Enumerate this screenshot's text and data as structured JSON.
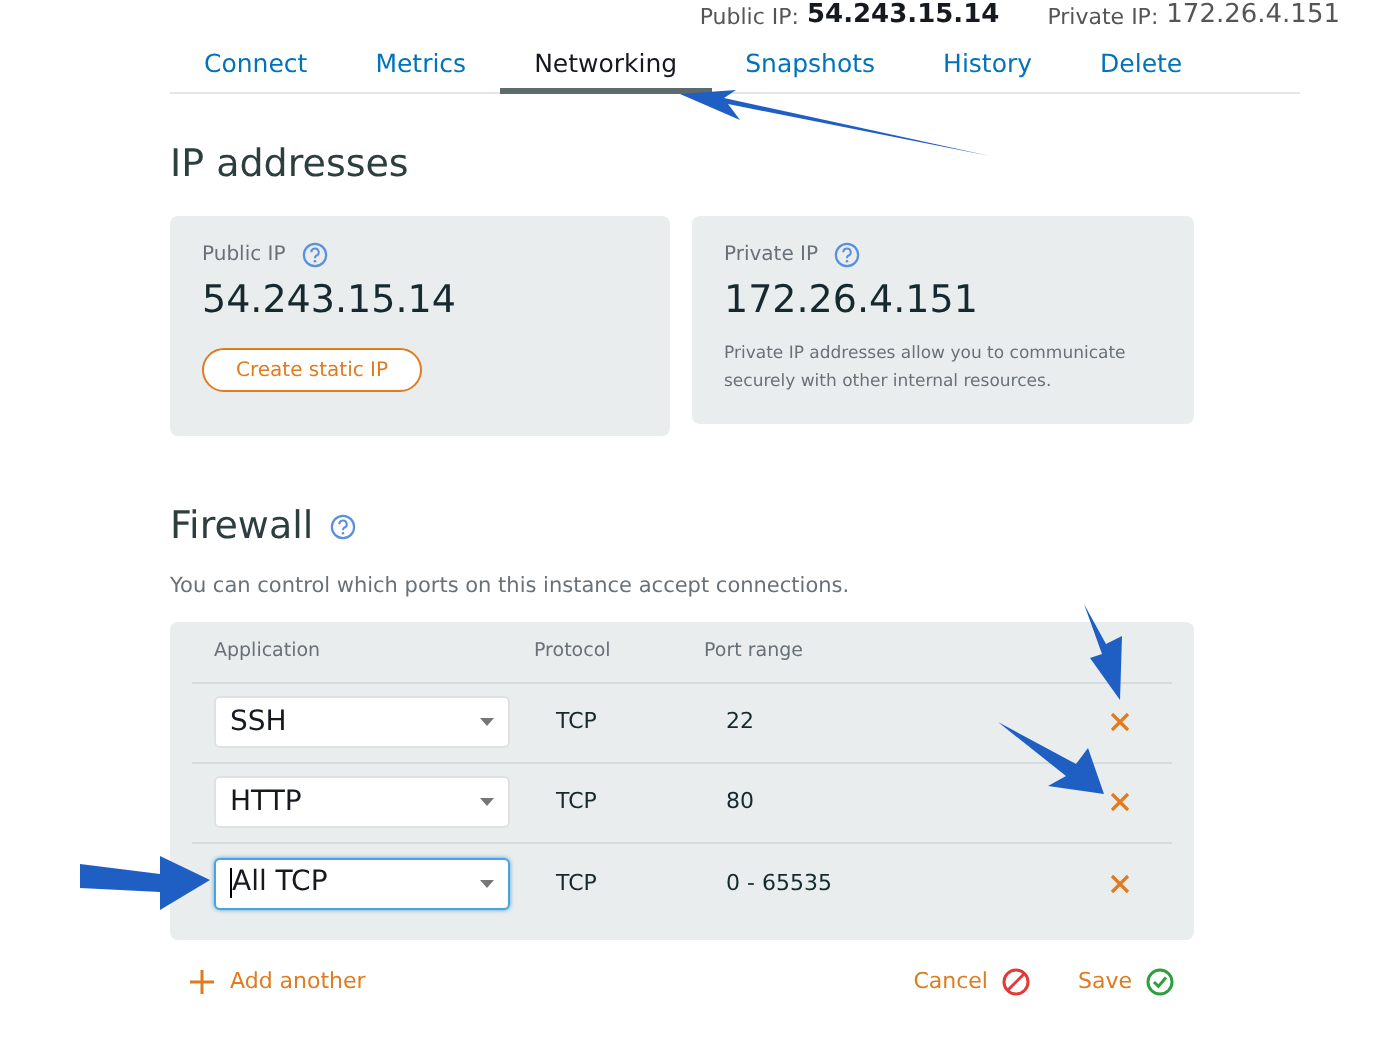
{
  "header": {
    "public_label": "Public IP:",
    "public_value": "54.243.15.14",
    "private_label": "Private IP:",
    "private_value": "172.26.4.151"
  },
  "tabs": [
    {
      "label": "Connect",
      "selected": false
    },
    {
      "label": "Metrics",
      "selected": false
    },
    {
      "label": "Networking",
      "selected": true
    },
    {
      "label": "Snapshots",
      "selected": false
    },
    {
      "label": "History",
      "selected": false
    },
    {
      "label": "Delete",
      "selected": false
    }
  ],
  "ip_section": {
    "title": "IP addresses",
    "public": {
      "label": "Public IP",
      "value": "54.243.15.14",
      "button": "Create static IP"
    },
    "private": {
      "label": "Private IP",
      "value": "172.26.4.151",
      "note": "Private IP addresses allow you to communicate securely with other internal resources."
    }
  },
  "firewall": {
    "title": "Firewall",
    "description": "You can control which ports on this instance accept connections.",
    "columns": [
      "Application",
      "Protocol",
      "Port range"
    ],
    "rows": [
      {
        "application": "SSH",
        "protocol": "TCP",
        "port_range": "22",
        "focused": false
      },
      {
        "application": "HTTP",
        "protocol": "TCP",
        "port_range": "80",
        "focused": false
      },
      {
        "application": "All TCP",
        "protocol": "TCP",
        "port_range": "0 - 65535",
        "focused": true
      }
    ],
    "add_label": "Add another",
    "cancel_label": "Cancel",
    "save_label": "Save"
  }
}
